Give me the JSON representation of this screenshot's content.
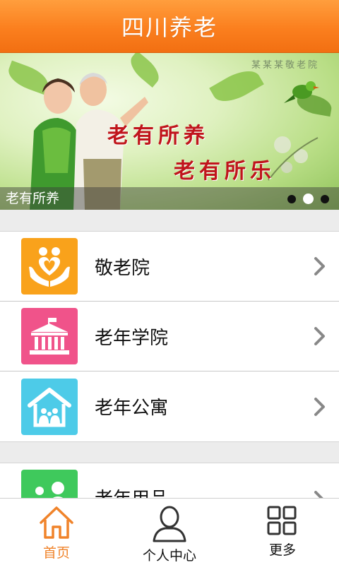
{
  "header": {
    "title": "四川养老"
  },
  "banner": {
    "watermark": "某某某敬老院",
    "slogan_line1": "老有所养",
    "slogan_line2": "老有所乐",
    "caption": "老有所养",
    "dots_total": 3,
    "dots_active_index": 1
  },
  "menu": {
    "items": [
      {
        "label": "敬老院",
        "icon": "hands-heart-icon",
        "color": "#f9a21b"
      },
      {
        "label": "老年学院",
        "icon": "academy-building-icon",
        "color": "#f0538a"
      },
      {
        "label": "老年公寓",
        "icon": "apartment-house-icon",
        "color": "#4dcbe8"
      },
      {
        "label": "老年用品",
        "icon": "people-icon",
        "color": "#3fc95c"
      }
    ]
  },
  "tabbar": {
    "tabs": [
      {
        "label": "首页",
        "icon": "home-icon",
        "active": true
      },
      {
        "label": "个人中心",
        "icon": "user-icon",
        "active": false
      },
      {
        "label": "更多",
        "icon": "grid-icon",
        "active": false
      }
    ]
  },
  "colors": {
    "accent": "#f0832a",
    "header": "#fb7f1e"
  }
}
